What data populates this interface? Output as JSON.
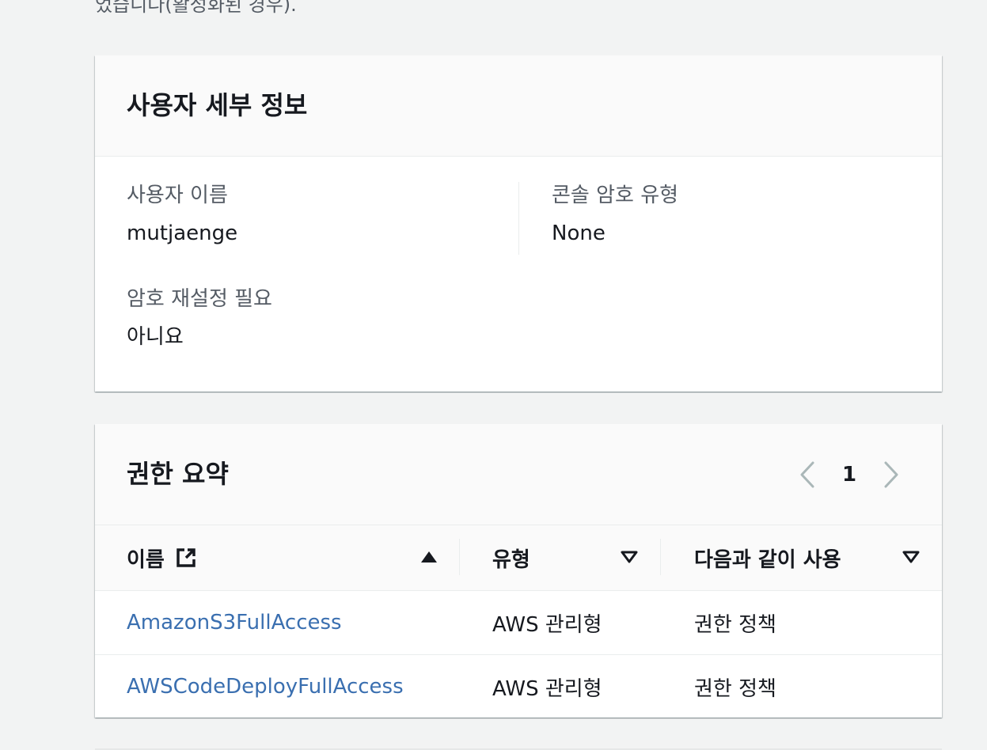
{
  "top_note": "었습니다(활성화된 경우).",
  "user_details": {
    "title": "사용자 세부 정보",
    "fields": [
      {
        "label": "사용자 이름",
        "value": "mutjaenge"
      },
      {
        "label": "콘솔 암호 유형",
        "value": "None"
      },
      {
        "label": "암호 재설정 필요",
        "value": "아니요"
      }
    ]
  },
  "permissions": {
    "title": "권한 요약",
    "pagination": {
      "current_page": "1"
    },
    "columns": [
      {
        "label": "이름",
        "sort": "ascending"
      },
      {
        "label": "유형",
        "sort": "none"
      },
      {
        "label": "다음과 같이 사용",
        "sort": "none"
      }
    ],
    "rows": [
      {
        "name": "AmazonS3FullAccess",
        "type": "AWS 관리형",
        "used_as": "권한 정책"
      },
      {
        "name": "AWSCodeDeployFullAccess",
        "type": "AWS 관리형",
        "used_as": "권한 정책"
      }
    ]
  },
  "colors": {
    "link": "#3a6fb0",
    "background": "#f2f3f3",
    "card": "#ffffff",
    "header": "#fafafa"
  }
}
